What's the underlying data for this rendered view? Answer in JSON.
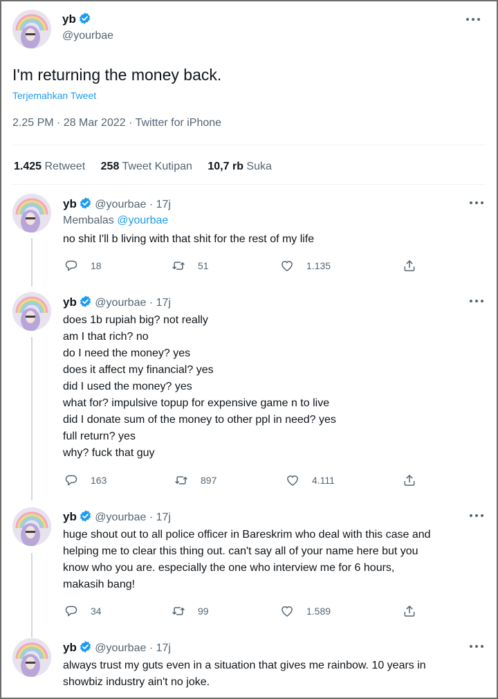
{
  "main_tweet": {
    "author_name": "yb",
    "author_handle": "@yourbae",
    "text": "I'm returning the money back.",
    "translate_label": "Terjemahkan Tweet",
    "meta": "2.25 PM · 28 Mar 2022 · Twitter for iPhone",
    "stats": {
      "retweets_count": "1.425",
      "retweets_label": "Retweet",
      "quotes_count": "258",
      "quotes_label": "Tweet Kutipan",
      "likes_count": "10,7 rb",
      "likes_label": "Suka"
    }
  },
  "replies": [
    {
      "name": "yb",
      "handle": "@yourbae",
      "time": "· 17j",
      "replying_prefix": "Membalas",
      "replying_to": "@yourbae",
      "lines": [
        "no shit I'll b living with that shit for the rest of my life"
      ],
      "replies_count": "18",
      "retweets_count": "51",
      "likes_count": "1.135"
    },
    {
      "name": "yb",
      "handle": "@yourbae",
      "time": "· 17j",
      "lines": [
        "does 1b rupiah big? not really",
        "am I that rich? no",
        "do I need the money? yes",
        "does it affect my financial? yes",
        "did I used the money? yes",
        "what for? impulsive topup for expensive game n to live",
        "did I donate sum of the money to other ppl in need? yes",
        "full return? yes",
        "why? fuck that guy"
      ],
      "replies_count": "163",
      "retweets_count": "897",
      "likes_count": "4.111"
    },
    {
      "name": "yb",
      "handle": "@yourbae",
      "time": "· 17j",
      "lines": [
        "huge shout out to all police officer in Bareskrim who deal with this case and",
        "helping me to clear this thing out. can't say all of your name here but you",
        "know who you are. especially the one who interview me for 6 hours,",
        "makasih bang!"
      ],
      "replies_count": "34",
      "retweets_count": "99",
      "likes_count": "1.589"
    },
    {
      "name": "yb",
      "handle": "@yourbae",
      "time": "· 17j",
      "lines": [
        "always trust my guts even in a situation that gives me rainbow. 10 years in",
        "showbiz industry ain't no joke."
      ]
    }
  ],
  "colors": {
    "text": "#0f1419",
    "secondary": "#536471",
    "link": "#1d9bf0",
    "verified": "#1d9bf0",
    "divider": "#eff3f4",
    "thread_line": "#cfd9de"
  },
  "icons": {
    "verified": "verified-badge-icon",
    "more": "more-horizontal-icon",
    "reply": "reply-bubble-icon",
    "retweet": "retweet-icon",
    "like": "heart-icon",
    "share": "share-icon"
  }
}
